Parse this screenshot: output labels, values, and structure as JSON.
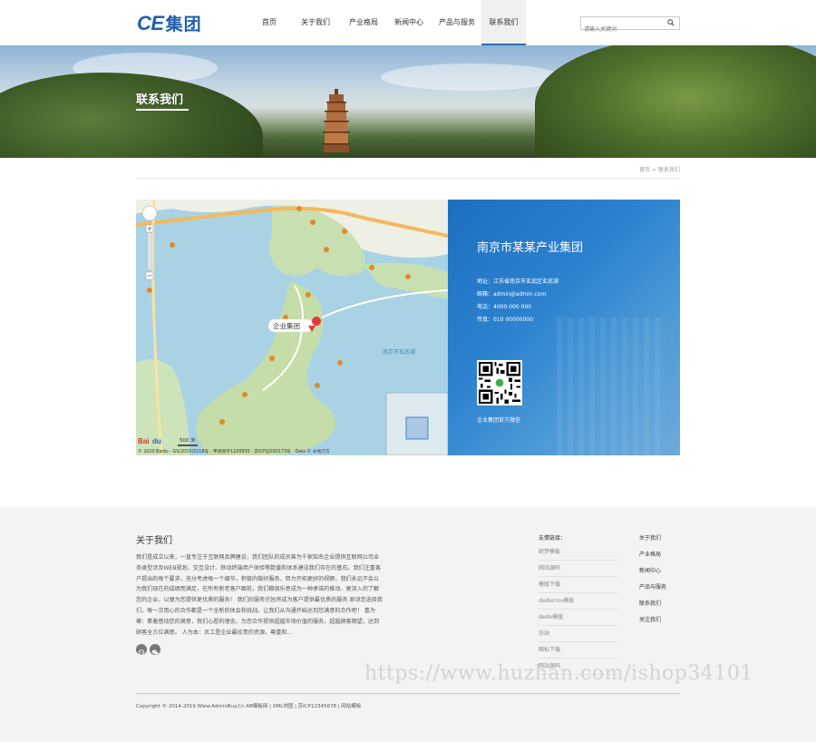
{
  "header": {
    "logo_latin": "CE",
    "logo_cn": "集团",
    "nav": [
      {
        "label": "首页",
        "active": false
      },
      {
        "label": "关于我们",
        "active": false
      },
      {
        "label": "产业格局",
        "active": false
      },
      {
        "label": "新闻中心",
        "active": false
      },
      {
        "label": "产品与服务",
        "active": false
      },
      {
        "label": "联系我们",
        "active": true
      }
    ],
    "search_placeholder": "请输入关键词"
  },
  "banner": {
    "title": "联系我们"
  },
  "breadcrumb": {
    "home": "首页",
    "separator": ">",
    "current": "联系我们"
  },
  "map": {
    "marker_label": "企业集团",
    "scale": "500 米",
    "attribution": "© 2020 Baidu - GS(2019)5218号 - 甲测资字1100930 - 京ICP证030173号 - Data © 长地万方",
    "lake_label": "南京市玄武湖"
  },
  "contact": {
    "company": "南京市某某产业集团",
    "address": "地址：江苏省南京市玄武区玄武湖",
    "email": "邮箱：admin@admin.com",
    "phone": "电话：4000 000 000",
    "fax": "传真：010 00000000",
    "qr_caption": "企业集团官方微信"
  },
  "footer": {
    "about_title": "关于我们",
    "about_text": "我们是成立以来，一直专注于互联网品牌建设，我们团队的成员曾为千家知名企业提供互联网公司业务类型涉及WEB规划、交互设计、移动终端用户体验等数量和体系建设我们存在的基石。我们注重客户提出的每个要求，充分考虑每一个细节，积极的做好服务，努力开拓更好的视野。我们永远不会以为我们现在的成绩而满足，在所有新老客户面前，我们都很乐意成为一种承诺的推动，更深入的了解您的企业，以便为您提供更优质的服务！ 我们的服务宗旨将成为客户提供最优质的服务 原谅您选择我们，每一次用心的合作都是一个全新的体会和挑战，让我们从沟通开始达到您满意的合作吧！ 喜为尊：素着感动您的满意，我们心愿的理念，为您合作提供超越市场价值的服务，超越顾客期望，达到顾客全方位满意。 人为本：员工是企业最珍贵的资源，尊重和...",
    "friend_links_title": "友情链接：",
    "friend_links": [
      "织梦模板",
      "网站源码",
      "模版下载",
      "dedecms模板",
      "dede模版",
      "仿站",
      "图标下载",
      "网站源码"
    ],
    "nav_links": [
      "关于我们",
      "产业格局",
      "新闻中心",
      "产品与服务",
      "联系我们",
      "关注我们"
    ],
    "copyright": "Copyright © 2014-2019 Www.AdminBuy.Cn AB模板网  |  XML地图  |  苏ICP12345678  |  网站模板",
    "watermark": "https://www.huzhan.com/ishop34101"
  },
  "colors": {
    "brand": "#1f5fae",
    "contact_panel": "#2c82cf",
    "footer_bg": "#f3f3f3"
  },
  "icons": {
    "search": "search-icon",
    "map_marker": "map-pin-icon",
    "weibo": "weibo-icon",
    "wechat": "wechat-icon",
    "qr": "qr-code"
  }
}
